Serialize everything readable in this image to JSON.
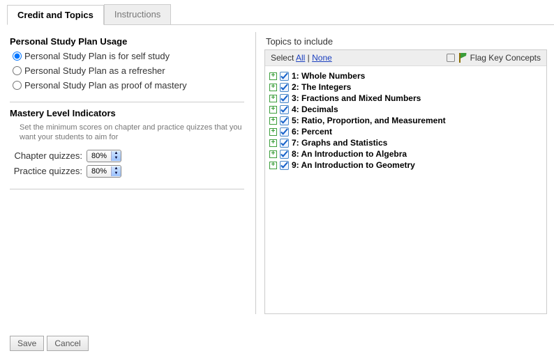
{
  "tabs": {
    "credit_topics": "Credit and Topics",
    "instructions": "Instructions"
  },
  "usage": {
    "heading": "Personal Study Plan Usage",
    "opts": [
      "Personal Study Plan is for self study",
      "Personal Study Plan as a refresher",
      "Personal Study Plan as proof of mastery"
    ]
  },
  "mastery": {
    "heading": "Mastery Level Indicators",
    "note": "Set the minimum scores on chapter and practice quizzes that you want your students to aim for",
    "rows": [
      {
        "label": "Chapter quizzes:",
        "value": "80%"
      },
      {
        "label": "Practice quizzes:",
        "value": "80%"
      }
    ]
  },
  "topics": {
    "heading": "Topics to include",
    "select_label": "Select",
    "all": "All",
    "none": "None",
    "flag_label": "Flag Key Concepts",
    "items": [
      "1: Whole Numbers",
      "2: The Integers",
      "3: Fractions and Mixed Numbers",
      "4: Decimals",
      "5: Ratio, Proportion, and Measurement",
      "6: Percent",
      "7: Graphs and Statistics",
      "8: An Introduction to Algebra",
      "9: An Introduction to Geometry"
    ]
  },
  "footer": {
    "save": "Save",
    "cancel": "Cancel"
  }
}
